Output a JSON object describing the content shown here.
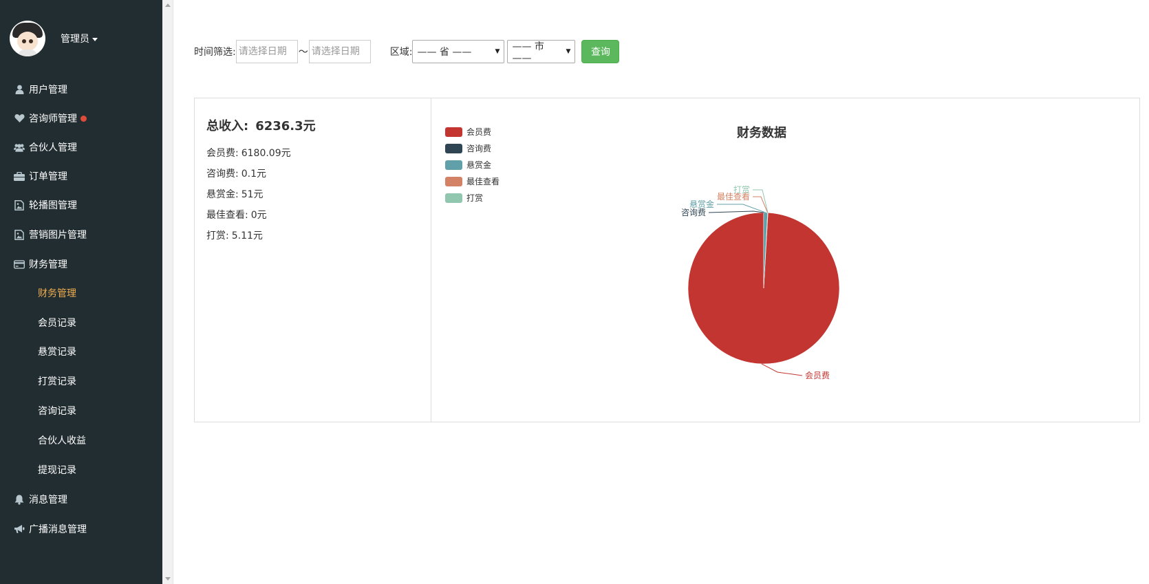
{
  "user": {
    "name": "管理员"
  },
  "menu": [
    {
      "label": "用户管理",
      "icon": "user-icon"
    },
    {
      "label": "咨询师管理",
      "icon": "heart-icon",
      "badge": true
    },
    {
      "label": "合伙人管理",
      "icon": "users-icon"
    },
    {
      "label": "订单管理",
      "icon": "briefcase-icon"
    },
    {
      "label": "轮播图管理",
      "icon": "image-icon"
    },
    {
      "label": "营销图片管理",
      "icon": "image-icon"
    },
    {
      "label": "财务管理",
      "icon": "credit-card-icon"
    }
  ],
  "submenu": [
    "财务管理",
    "会员记录",
    "悬赏记录",
    "打赏记录",
    "咨询记录",
    "合伙人收益",
    "提现记录"
  ],
  "menu_bottom": [
    {
      "label": "消息管理",
      "icon": "bell-icon"
    },
    {
      "label": "广播消息管理",
      "icon": "bullhorn-icon"
    }
  ],
  "filter": {
    "time_label": "时间筛选:",
    "start_placeholder": "请选择日期",
    "separator": "〜",
    "end_placeholder": "请选择日期",
    "region_label": "区域:",
    "province": "—— 省 ——",
    "city": "—— 市 ——",
    "query": "查询"
  },
  "summary": {
    "total_label": "总收入:",
    "total_value": "6236.3元",
    "items": [
      {
        "label": "会员费:",
        "value": "6180.09元"
      },
      {
        "label": "咨询费:",
        "value": "0.1元"
      },
      {
        "label": "悬赏金:",
        "value": "51元"
      },
      {
        "label": "最佳查看:",
        "value": "0元"
      },
      {
        "label": "打赏:",
        "value": "5.11元"
      }
    ]
  },
  "chart_data": {
    "type": "pie",
    "title": "财务数据",
    "legend_position": "top-left",
    "categories": [
      "会员费",
      "咨询费",
      "悬赏金",
      "最佳查看",
      "打赏"
    ],
    "values": [
      6180.09,
      0.1,
      51,
      0,
      5.11
    ],
    "colors": [
      "#c23531",
      "#2f4554",
      "#61a0a8",
      "#d48265",
      "#91c7ae"
    ]
  }
}
